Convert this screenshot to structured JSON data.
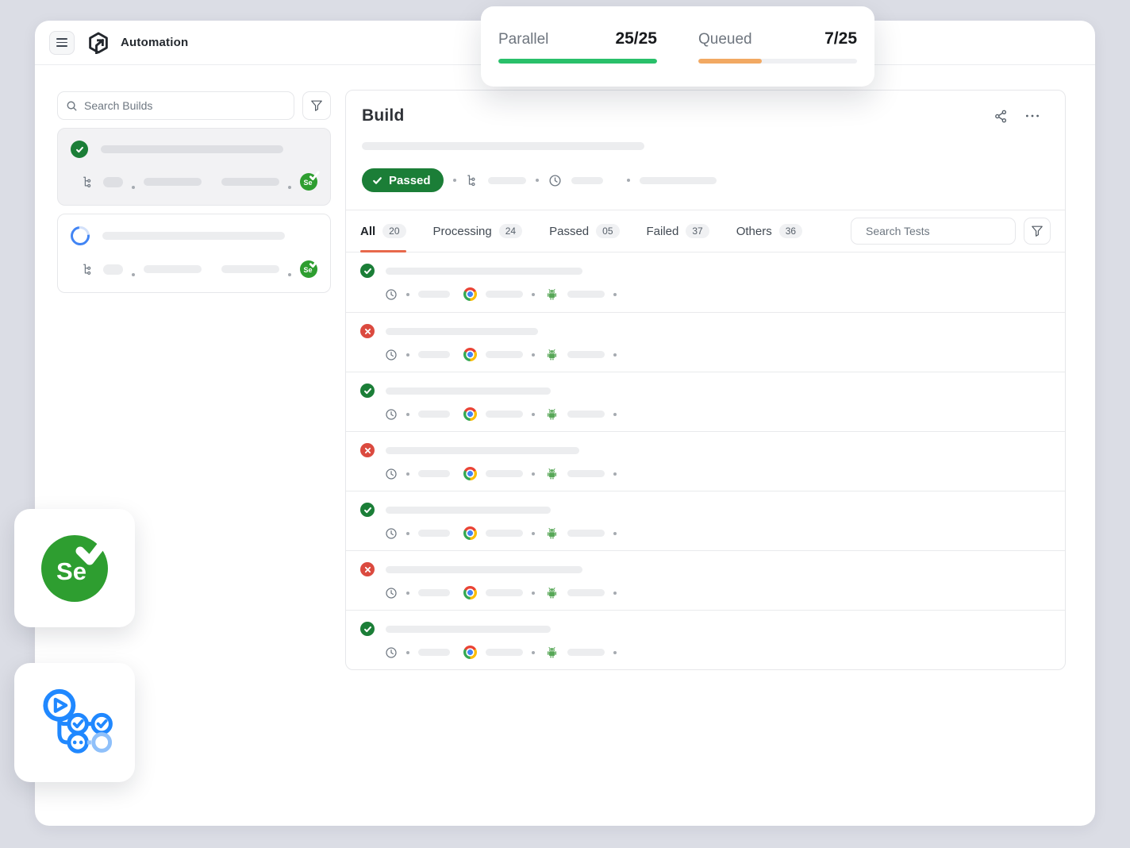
{
  "header": {
    "app_title": "Automation"
  },
  "stats": [
    {
      "label": "Parallel",
      "value": "25/25",
      "progress": 100,
      "fill": "green"
    },
    {
      "label": "Queued",
      "value": "7/25",
      "progress": 40,
      "fill": "orange"
    }
  ],
  "sidebar": {
    "search_placeholder": "Search Builds",
    "builds": [
      {
        "status": "passed",
        "selected": true
      },
      {
        "status": "running",
        "selected": false
      }
    ]
  },
  "main": {
    "title": "Build",
    "status_badge": "Passed",
    "search_placeholder": "Search Tests",
    "tabs": [
      {
        "label": "All",
        "count": "20",
        "active": true
      },
      {
        "label": "Processing",
        "count": "24",
        "active": false
      },
      {
        "label": "Passed",
        "count": "05",
        "active": false
      },
      {
        "label": "Failed",
        "count": "37",
        "active": false
      },
      {
        "label": "Others",
        "count": "36",
        "active": false
      }
    ],
    "rows": [
      {
        "status": "passed",
        "title_w": 248
      },
      {
        "status": "failed",
        "title_w": 192
      },
      {
        "status": "passed",
        "title_w": 208
      },
      {
        "status": "failed",
        "title_w": 244
      },
      {
        "status": "passed",
        "title_w": 208
      },
      {
        "status": "failed",
        "title_w": 248
      },
      {
        "status": "passed",
        "title_w": 208
      }
    ]
  },
  "selenium": {
    "label": "Se"
  },
  "colors": {
    "page_bg": "#DBDDE5",
    "success": "#1B7E37",
    "danger": "#DB4A3F",
    "progress_green": "#29C06A",
    "progress_orange": "#F2A963",
    "tab_underline": "#E8694C",
    "selenium_green": "#2E9E30",
    "pipeline_blue": "#2088FF",
    "pipeline_blue_light": "#8FC0FA",
    "spinner_blue": "#4285F4",
    "android_green": "#57A757"
  }
}
